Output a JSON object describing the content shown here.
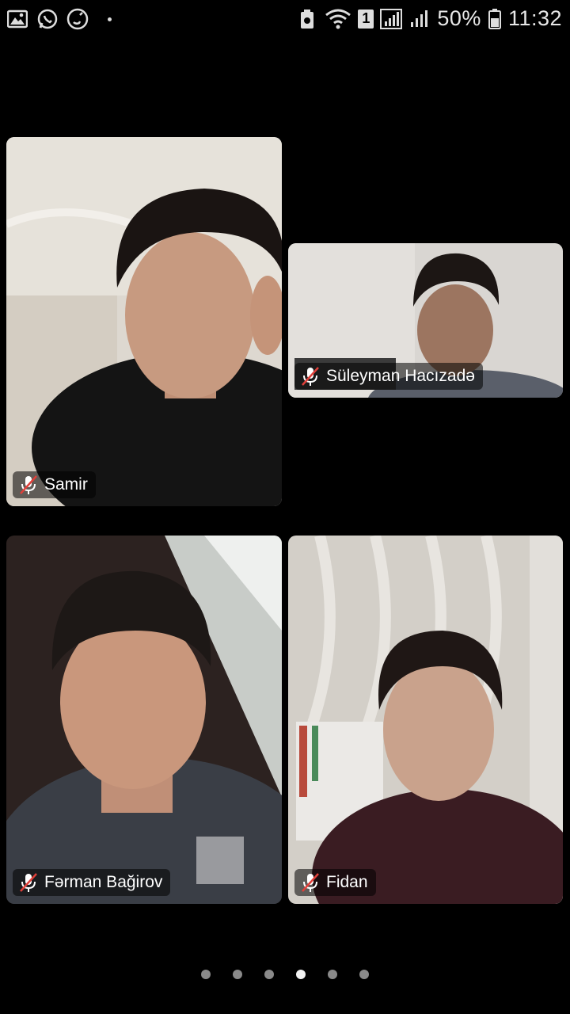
{
  "status_bar": {
    "battery": "50%",
    "time": "11:32",
    "sim_badge": "1",
    "left_icons": [
      "gallery-icon",
      "whatsapp-icon",
      "phone-icon"
    ],
    "right_icons": [
      "battery-saver-icon",
      "wifi-icon",
      "signal-icon",
      "battery-icon"
    ]
  },
  "participants": [
    {
      "name": "Samir",
      "muted": true
    },
    {
      "name": "Süleyman Hacızadə",
      "muted": true
    },
    {
      "name": "Fərman Bağirov",
      "muted": true
    },
    {
      "name": "Fidan",
      "muted": true
    }
  ],
  "pagination": {
    "total": 6,
    "active_index": 3
  }
}
